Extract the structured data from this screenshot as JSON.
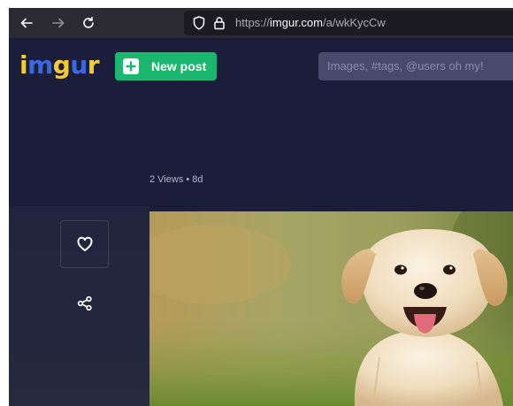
{
  "browser": {
    "back_icon": "arrow-left-icon",
    "forward_icon": "arrow-right-icon",
    "reload_icon": "reload-icon",
    "url_prefix": "https://",
    "url_host": "imgur.com",
    "url_path": "/a/wkKycCw"
  },
  "header": {
    "logo_text": "imgur",
    "new_post_label": "New post",
    "search_placeholder": "Images, #tags, @users oh my!"
  },
  "post": {
    "meta": "2 Views • 8d",
    "like_icon": "heart-icon",
    "share_icon": "share-icon"
  },
  "colors": {
    "accent": "#1bb76e",
    "page_bg": "#1b1e3a",
    "logo_yellow": "#f5cc2f",
    "logo_blue": "#3b67e0"
  }
}
